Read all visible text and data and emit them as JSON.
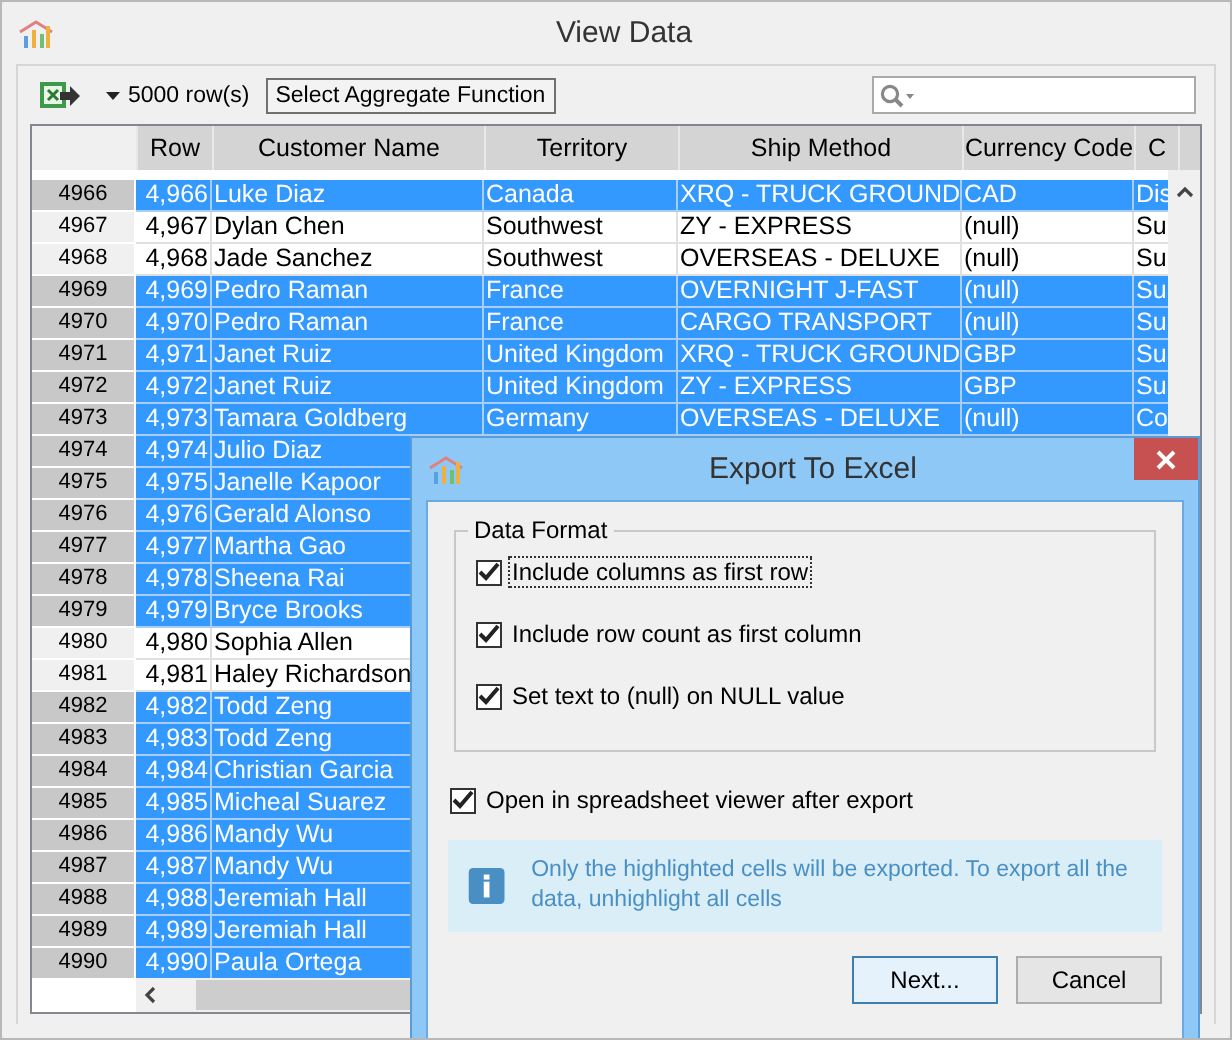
{
  "window": {
    "title": "View Data"
  },
  "toolbar": {
    "row_count": "5000 row(s)",
    "aggregate_button": "Select Aggregate Function"
  },
  "table": {
    "columns": [
      "Row",
      "Customer Name",
      "Territory",
      "Ship Method",
      "Currency Code",
      "C"
    ],
    "rows": [
      {
        "header": "4966",
        "selected": true,
        "cells": [
          "4,966",
          "Luke Diaz",
          "Canada",
          "XRQ - TRUCK GROUND",
          "CAD",
          "Dis"
        ]
      },
      {
        "header": "4967",
        "selected": false,
        "cells": [
          "4,967",
          "Dylan Chen",
          "Southwest",
          "ZY - EXPRESS",
          "(null)",
          "Su"
        ]
      },
      {
        "header": "4968",
        "selected": false,
        "cells": [
          "4,968",
          "Jade Sanchez",
          "Southwest",
          "OVERSEAS - DELUXE",
          "(null)",
          "Su"
        ]
      },
      {
        "header": "4969",
        "selected": true,
        "cells": [
          "4,969",
          "Pedro Raman",
          "France",
          "OVERNIGHT J-FAST",
          "(null)",
          "Su"
        ]
      },
      {
        "header": "4970",
        "selected": true,
        "cells": [
          "4,970",
          "Pedro Raman",
          "France",
          "CARGO TRANSPORT",
          "(null)",
          "Su"
        ]
      },
      {
        "header": "4971",
        "selected": true,
        "cells": [
          "4,971",
          "Janet Ruiz",
          "United Kingdom",
          "XRQ - TRUCK GROUND",
          "GBP",
          "Su"
        ]
      },
      {
        "header": "4972",
        "selected": true,
        "cells": [
          "4,972",
          "Janet Ruiz",
          "United Kingdom",
          "ZY - EXPRESS",
          "GBP",
          "Su"
        ]
      },
      {
        "header": "4973",
        "selected": true,
        "cells": [
          "4,973",
          "Tamara Goldberg",
          "Germany",
          "OVERSEAS - DELUXE",
          "(null)",
          "Co"
        ]
      },
      {
        "header": "4974",
        "selected": true,
        "cells": [
          "4,974",
          "Julio Diaz"
        ]
      },
      {
        "header": "4975",
        "selected": true,
        "cells": [
          "4,975",
          "Janelle Kapoor"
        ]
      },
      {
        "header": "4976",
        "selected": true,
        "cells": [
          "4,976",
          "Gerald Alonso"
        ]
      },
      {
        "header": "4977",
        "selected": true,
        "cells": [
          "4,977",
          "Martha Gao"
        ]
      },
      {
        "header": "4978",
        "selected": true,
        "cells": [
          "4,978",
          "Sheena Rai"
        ]
      },
      {
        "header": "4979",
        "selected": true,
        "cells": [
          "4,979",
          "Bryce Brooks"
        ]
      },
      {
        "header": "4980",
        "selected": false,
        "cells": [
          "4,980",
          "Sophia Allen"
        ]
      },
      {
        "header": "4981",
        "selected": false,
        "cells": [
          "4,981",
          "Haley Richardson"
        ]
      },
      {
        "header": "4982",
        "selected": true,
        "cells": [
          "4,982",
          "Todd Zeng"
        ]
      },
      {
        "header": "4983",
        "selected": true,
        "cells": [
          "4,983",
          "Todd Zeng"
        ]
      },
      {
        "header": "4984",
        "selected": true,
        "cells": [
          "4,984",
          "Christian Garcia"
        ]
      },
      {
        "header": "4985",
        "selected": true,
        "cells": [
          "4,985",
          "Micheal Suarez"
        ]
      },
      {
        "header": "4986",
        "selected": true,
        "cells": [
          "4,986",
          "Mandy Wu"
        ]
      },
      {
        "header": "4987",
        "selected": true,
        "cells": [
          "4,987",
          "Mandy Wu"
        ]
      },
      {
        "header": "4988",
        "selected": true,
        "cells": [
          "4,988",
          "Jeremiah Hall"
        ]
      },
      {
        "header": "4989",
        "selected": true,
        "cells": [
          "4,989",
          "Jeremiah Hall"
        ]
      },
      {
        "header": "4990",
        "selected": true,
        "cells": [
          "4,990",
          "Paula Ortega"
        ]
      }
    ]
  },
  "dialog": {
    "title": "Export To Excel",
    "group_title": "Data Format",
    "options": [
      {
        "label": "Include columns as first row",
        "checked": true,
        "focused": true
      },
      {
        "label": "Include row count as first column",
        "checked": true,
        "focused": false
      },
      {
        "label": "Set text to (null) on NULL value",
        "checked": true,
        "focused": false
      }
    ],
    "open_after": {
      "label": "Open in spreadsheet viewer after export",
      "checked": true
    },
    "info": "Only the highlighted cells will be exported. To export all the data, unhighlight all cells",
    "buttons": [
      {
        "label": "Next...",
        "default": true
      },
      {
        "label": "Cancel",
        "default": false
      }
    ]
  }
}
